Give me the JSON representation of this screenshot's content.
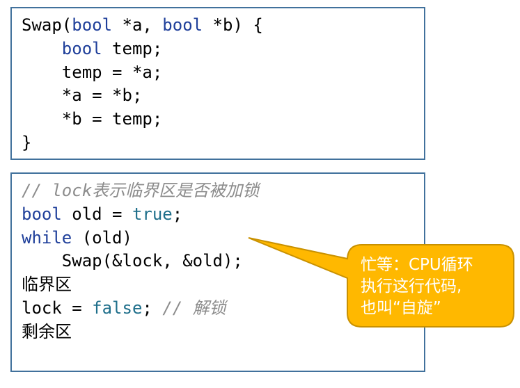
{
  "swap_box": {
    "lines": [
      [
        {
          "t": "Swap(",
          "c": ""
        },
        {
          "t": "bool",
          "c": "kw"
        },
        {
          "t": " *a, ",
          "c": ""
        },
        {
          "t": "bool",
          "c": "kw"
        },
        {
          "t": " *b) {",
          "c": ""
        }
      ],
      [
        {
          "t": "    ",
          "c": ""
        },
        {
          "t": "bool",
          "c": "kw"
        },
        {
          "t": " temp;",
          "c": ""
        }
      ],
      [
        {
          "t": "    temp = *a;",
          "c": ""
        }
      ],
      [
        {
          "t": "    *a = *b;",
          "c": ""
        }
      ],
      [
        {
          "t": "    *b = temp;",
          "c": ""
        }
      ],
      [
        {
          "t": "}",
          "c": ""
        }
      ]
    ]
  },
  "lock_box": {
    "lines": [
      [
        {
          "t": "// lock表示临界区是否被加锁",
          "c": "cm"
        }
      ],
      [
        {
          "t": "bool",
          "c": "kw"
        },
        {
          "t": " old = ",
          "c": ""
        },
        {
          "t": "true",
          "c": "lit"
        },
        {
          "t": ";",
          "c": ""
        }
      ],
      [
        {
          "t": "while",
          "c": "kw"
        },
        {
          "t": " (old)",
          "c": ""
        }
      ],
      [
        {
          "t": "    Swap(&lock, &old);",
          "c": ""
        }
      ],
      [
        {
          "t": "临界区",
          "c": "cjk"
        }
      ],
      [
        {
          "t": "lock = ",
          "c": ""
        },
        {
          "t": "false",
          "c": "lit"
        },
        {
          "t": "; ",
          "c": ""
        },
        {
          "t": "// 解锁",
          "c": "cm"
        }
      ],
      [
        {
          "t": "剩余区",
          "c": "cjk"
        }
      ]
    ]
  },
  "callout": {
    "lines": [
      "忙等：CPU循环",
      "执行这行代码,",
      "也叫“自旋”"
    ],
    "fill": "#ffb800",
    "stroke": "#c99100"
  }
}
